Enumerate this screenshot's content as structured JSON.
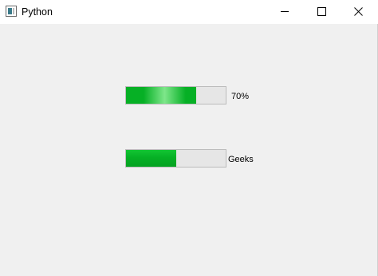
{
  "window": {
    "title": "Python",
    "icon": "app-window-icon"
  },
  "controls": {
    "minimize": "minimize-icon",
    "maximize": "maximize-icon",
    "close": "close-icon"
  },
  "progress_bars": [
    {
      "value_percent": 70,
      "label": "70%",
      "bar_color": "#06b025"
    },
    {
      "value_percent": 50,
      "label": "Geeks",
      "bar_color": "#06b025"
    }
  ],
  "colors": {
    "client_bg": "#f0f0f0",
    "track": "#e6e6e6",
    "track_border": "#bcbcbc",
    "fill": "#06b025"
  }
}
